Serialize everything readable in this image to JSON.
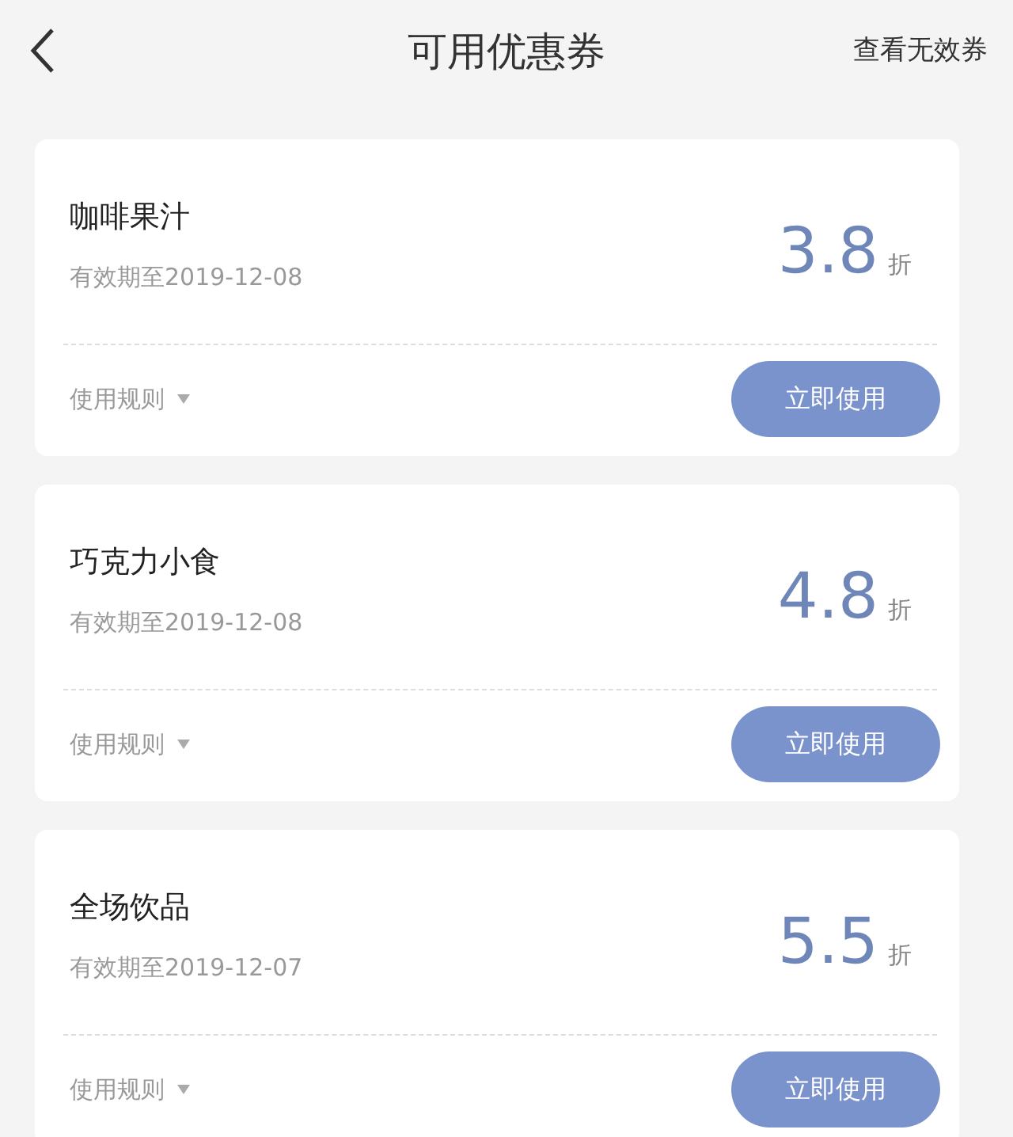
{
  "header": {
    "title": "可用优惠券",
    "action": "查看无效券"
  },
  "coupons": [
    {
      "name": "咖啡果汁",
      "expiry": "有效期至2019-12-08",
      "value": "3.8",
      "unit": "折",
      "rules": "使用规则",
      "button": "立即使用"
    },
    {
      "name": "巧克力小食",
      "expiry": "有效期至2019-12-08",
      "value": "4.8",
      "unit": "折",
      "rules": "使用规则",
      "button": "立即使用"
    },
    {
      "name": "全场饮品",
      "expiry": "有效期至2019-12-07",
      "value": "5.5",
      "unit": "折",
      "rules": "使用规则",
      "button": "立即使用"
    }
  ]
}
